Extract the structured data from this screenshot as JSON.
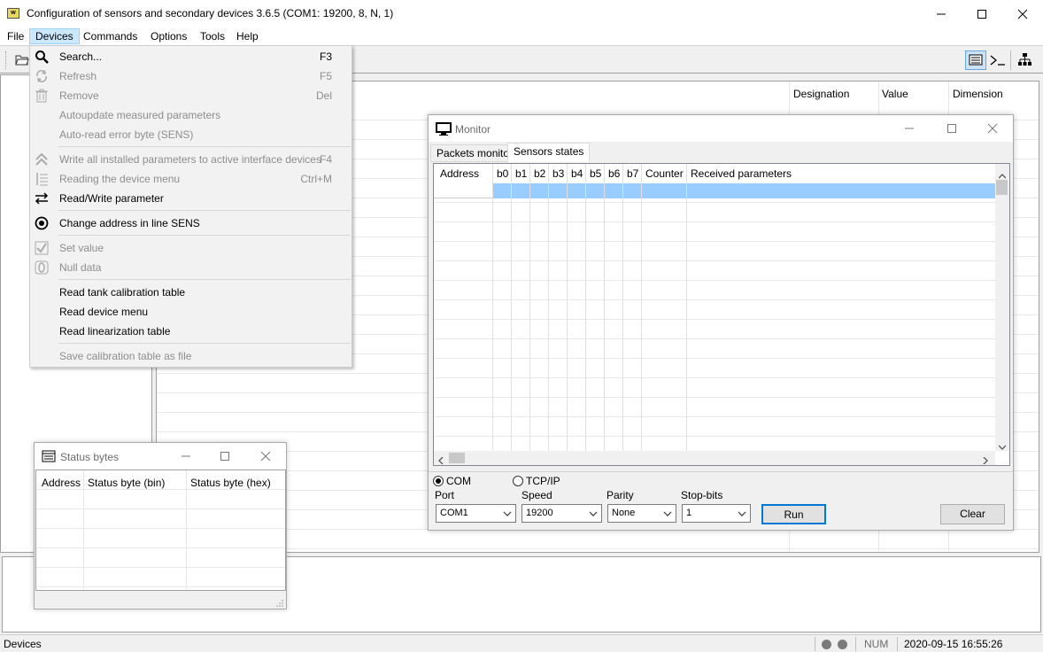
{
  "window": {
    "title": "Configuration of sensors and secondary devices 3.6.5 (COM1: 19200, 8, N, 1)",
    "app_icon": "app-icon",
    "minimize_icon": "minimize-icon",
    "maximize_icon": "maximize-icon",
    "close_icon": "close-icon"
  },
  "menubar": {
    "items": [
      {
        "label": "File"
      },
      {
        "label": "Devices",
        "active": true
      },
      {
        "label": "Commands"
      },
      {
        "label": "Options"
      },
      {
        "label": "Tools"
      },
      {
        "label": "Help"
      }
    ]
  },
  "toolbar": {
    "open_icon": "folder-open-icon",
    "monitor_toggle_icon": "monitor-panel-icon",
    "terminal_icon": "terminal-icon",
    "tree_icon": "network-tree-icon"
  },
  "devices_menu": {
    "items": [
      {
        "label": "Search...",
        "shortcut": "F3",
        "icon": "search-icon",
        "enabled": true
      },
      {
        "label": "Refresh",
        "shortcut": "F5",
        "icon": "refresh-icon",
        "enabled": false
      },
      {
        "label": "Remove",
        "shortcut": "Del",
        "icon": "trash-icon",
        "enabled": false
      },
      {
        "label": "Autoupdate measured parameters",
        "shortcut": "",
        "icon": "",
        "enabled": false
      },
      {
        "label": "Auto-read error byte (SENS)",
        "shortcut": "",
        "icon": "",
        "enabled": false
      },
      {
        "label": "Write all installed parameters to active interface devices",
        "shortcut": "F4",
        "icon": "double-chevron-up-icon",
        "enabled": false
      },
      {
        "label": "Reading the device menu",
        "shortcut": "Ctrl+M",
        "icon": "list-numbered-icon",
        "enabled": false
      },
      {
        "label": "Read/Write parameter",
        "shortcut": "",
        "icon": "swap-arrows-icon",
        "enabled": true
      },
      {
        "label": "Change address in line SENS",
        "shortcut": "",
        "icon": "target-icon",
        "enabled": true
      },
      {
        "label": "Set value",
        "shortcut": "",
        "icon": "checkmark-box-icon",
        "enabled": false
      },
      {
        "label": "Null data",
        "shortcut": "",
        "icon": "zero-icon",
        "enabled": false
      },
      {
        "label": "Read tank calibration table",
        "shortcut": "",
        "icon": "",
        "enabled": true
      },
      {
        "label": "Read device menu",
        "shortcut": "",
        "icon": "",
        "enabled": true
      },
      {
        "label": "Read linearization table",
        "shortcut": "",
        "icon": "",
        "enabled": true
      },
      {
        "label": "Save calibration table as file",
        "shortcut": "",
        "icon": "",
        "enabled": false
      }
    ]
  },
  "main_table": {
    "columns": [
      "Designation",
      "Value",
      "Dimension"
    ]
  },
  "monitor": {
    "title": "Monitor",
    "tabs": [
      "Packets monitor",
      "Sensors states"
    ],
    "selected_tab": "Sensors states",
    "columns": [
      "Address",
      "b0",
      "b1",
      "b2",
      "b3",
      "b4",
      "b5",
      "b6",
      "b7",
      "Counter",
      "Received parameters"
    ],
    "connection": {
      "com_label": "COM",
      "tcp_label": "TCP/IP",
      "selected": "COM",
      "port_label": "Port",
      "port_value": "COM1",
      "speed_label": "Speed",
      "speed_value": "19200",
      "parity_label": "Parity",
      "parity_value": "None",
      "stopbits_label": "Stop-bits",
      "stopbits_value": "1",
      "run_label": "Run",
      "clear_label": "Clear"
    }
  },
  "status_bytes": {
    "title": "Status bytes",
    "columns": [
      "Address",
      "Status byte (bin)",
      "Status byte (hex)"
    ]
  },
  "statusbar": {
    "left": "Devices",
    "num": "NUM",
    "datetime": "2020-09-15 16:55:26"
  }
}
